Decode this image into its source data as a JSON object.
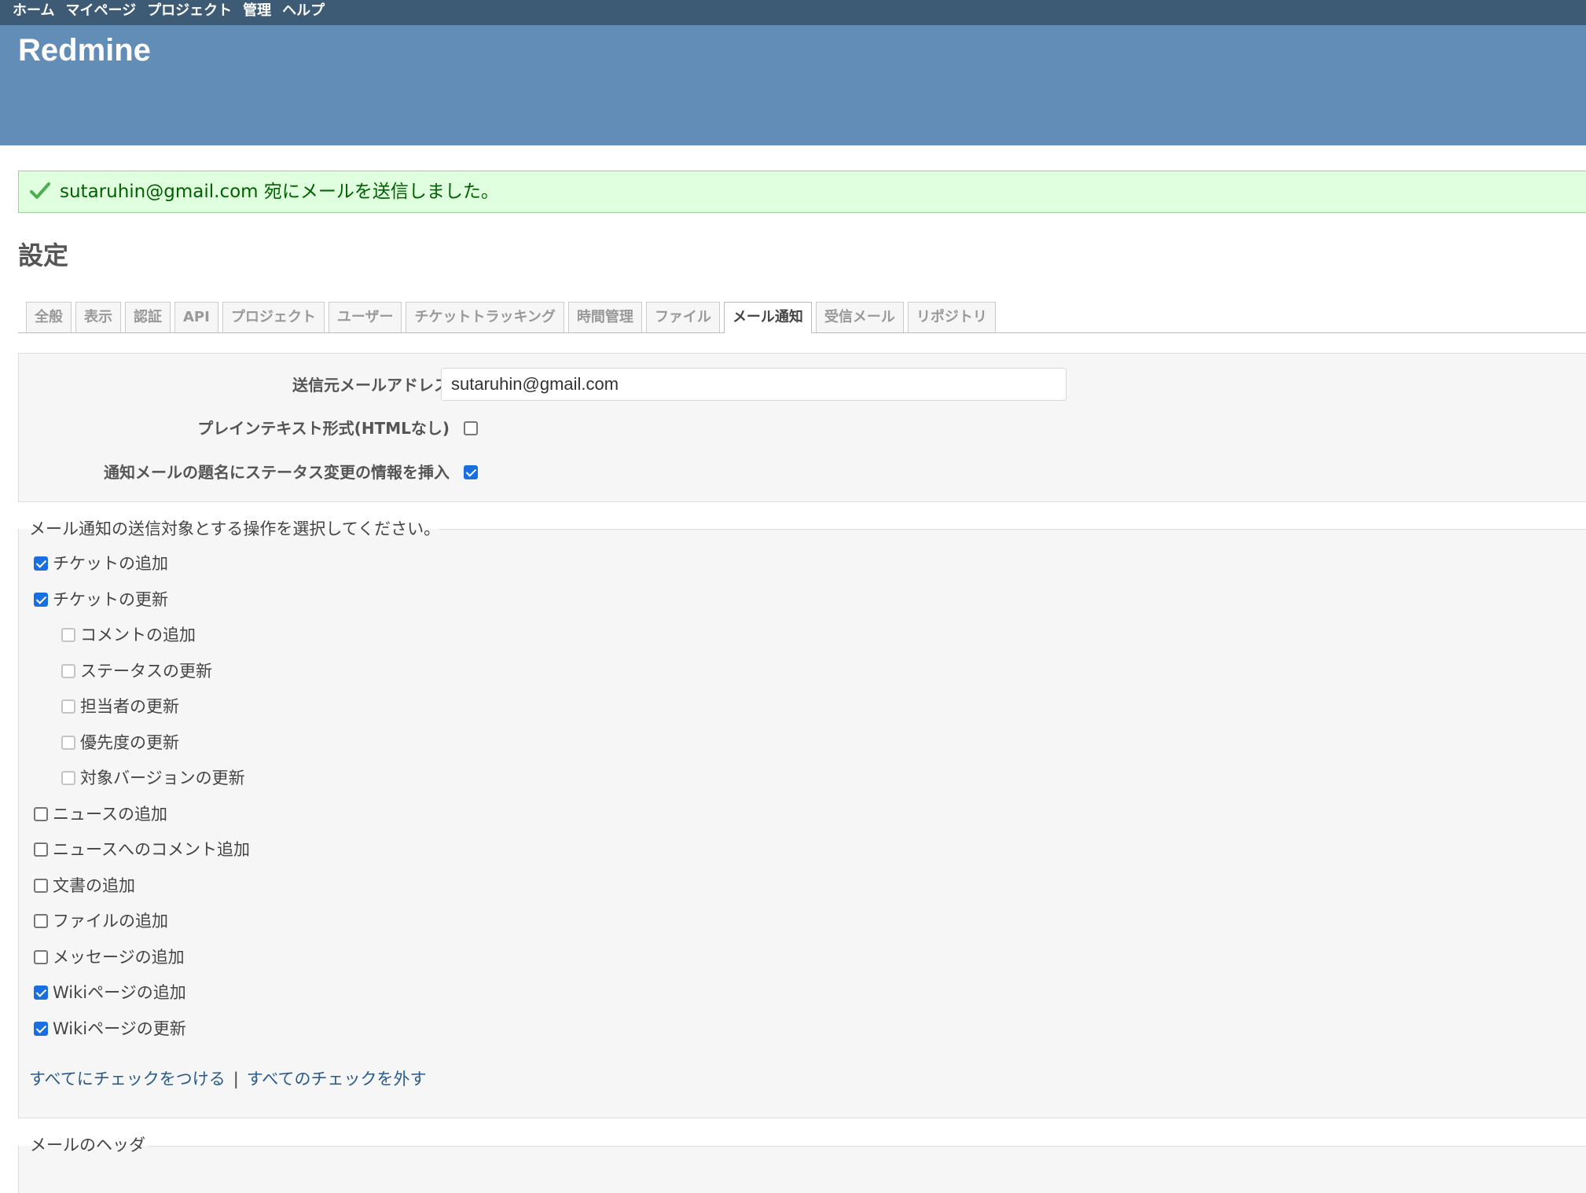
{
  "top_menu": [
    "ホーム",
    "マイページ",
    "プロジェクト",
    "管理",
    "ヘルプ"
  ],
  "header": {
    "title": "Redmine"
  },
  "flash": {
    "message": "sutaruhin@gmail.com 宛にメールを送信しました。"
  },
  "page": {
    "title": "設定"
  },
  "tabs": [
    "全般",
    "表示",
    "認証",
    "API",
    "プロジェクト",
    "ユーザー",
    "チケットトラッキング",
    "時間管理",
    "ファイル",
    "メール通知",
    "受信メール",
    "リポジトリ"
  ],
  "selected_tab": "メール通知",
  "general": {
    "from_label": "送信元メールアドレス",
    "from_value": "sutaruhin@gmail.com",
    "plain_label": "プレインテキスト形式(HTMLなし)",
    "plain_checked": false,
    "status_label": "通知メールの題名にステータス変更の情報を挿入",
    "status_checked": true
  },
  "actions": {
    "legend": "メール通知の送信対象とする操作を選択してください。",
    "items": [
      {
        "label": "チケットの追加",
        "checked": true
      },
      {
        "label": "チケットの更新",
        "checked": true
      },
      {
        "label": "コメントの追加",
        "checked": false
      },
      {
        "label": "ステータスの更新",
        "checked": false
      },
      {
        "label": "担当者の更新",
        "checked": false
      },
      {
        "label": "優先度の更新",
        "checked": false
      },
      {
        "label": "対象バージョンの更新",
        "checked": false
      },
      {
        "label": "ニュースの追加",
        "checked": false
      },
      {
        "label": "ニュースへのコメント追加",
        "checked": false
      },
      {
        "label": "文書の追加",
        "checked": false
      },
      {
        "label": "ファイルの追加",
        "checked": false
      },
      {
        "label": "メッセージの追加",
        "checked": false
      },
      {
        "label": "Wikiページの追加",
        "checked": true
      },
      {
        "label": "Wikiページの更新",
        "checked": true
      }
    ],
    "check_all": "すべてにチェックをつける",
    "separator": "|",
    "uncheck_all": "すべてのチェックを外す"
  },
  "header_section": {
    "legend": "メールのヘッダ"
  }
}
